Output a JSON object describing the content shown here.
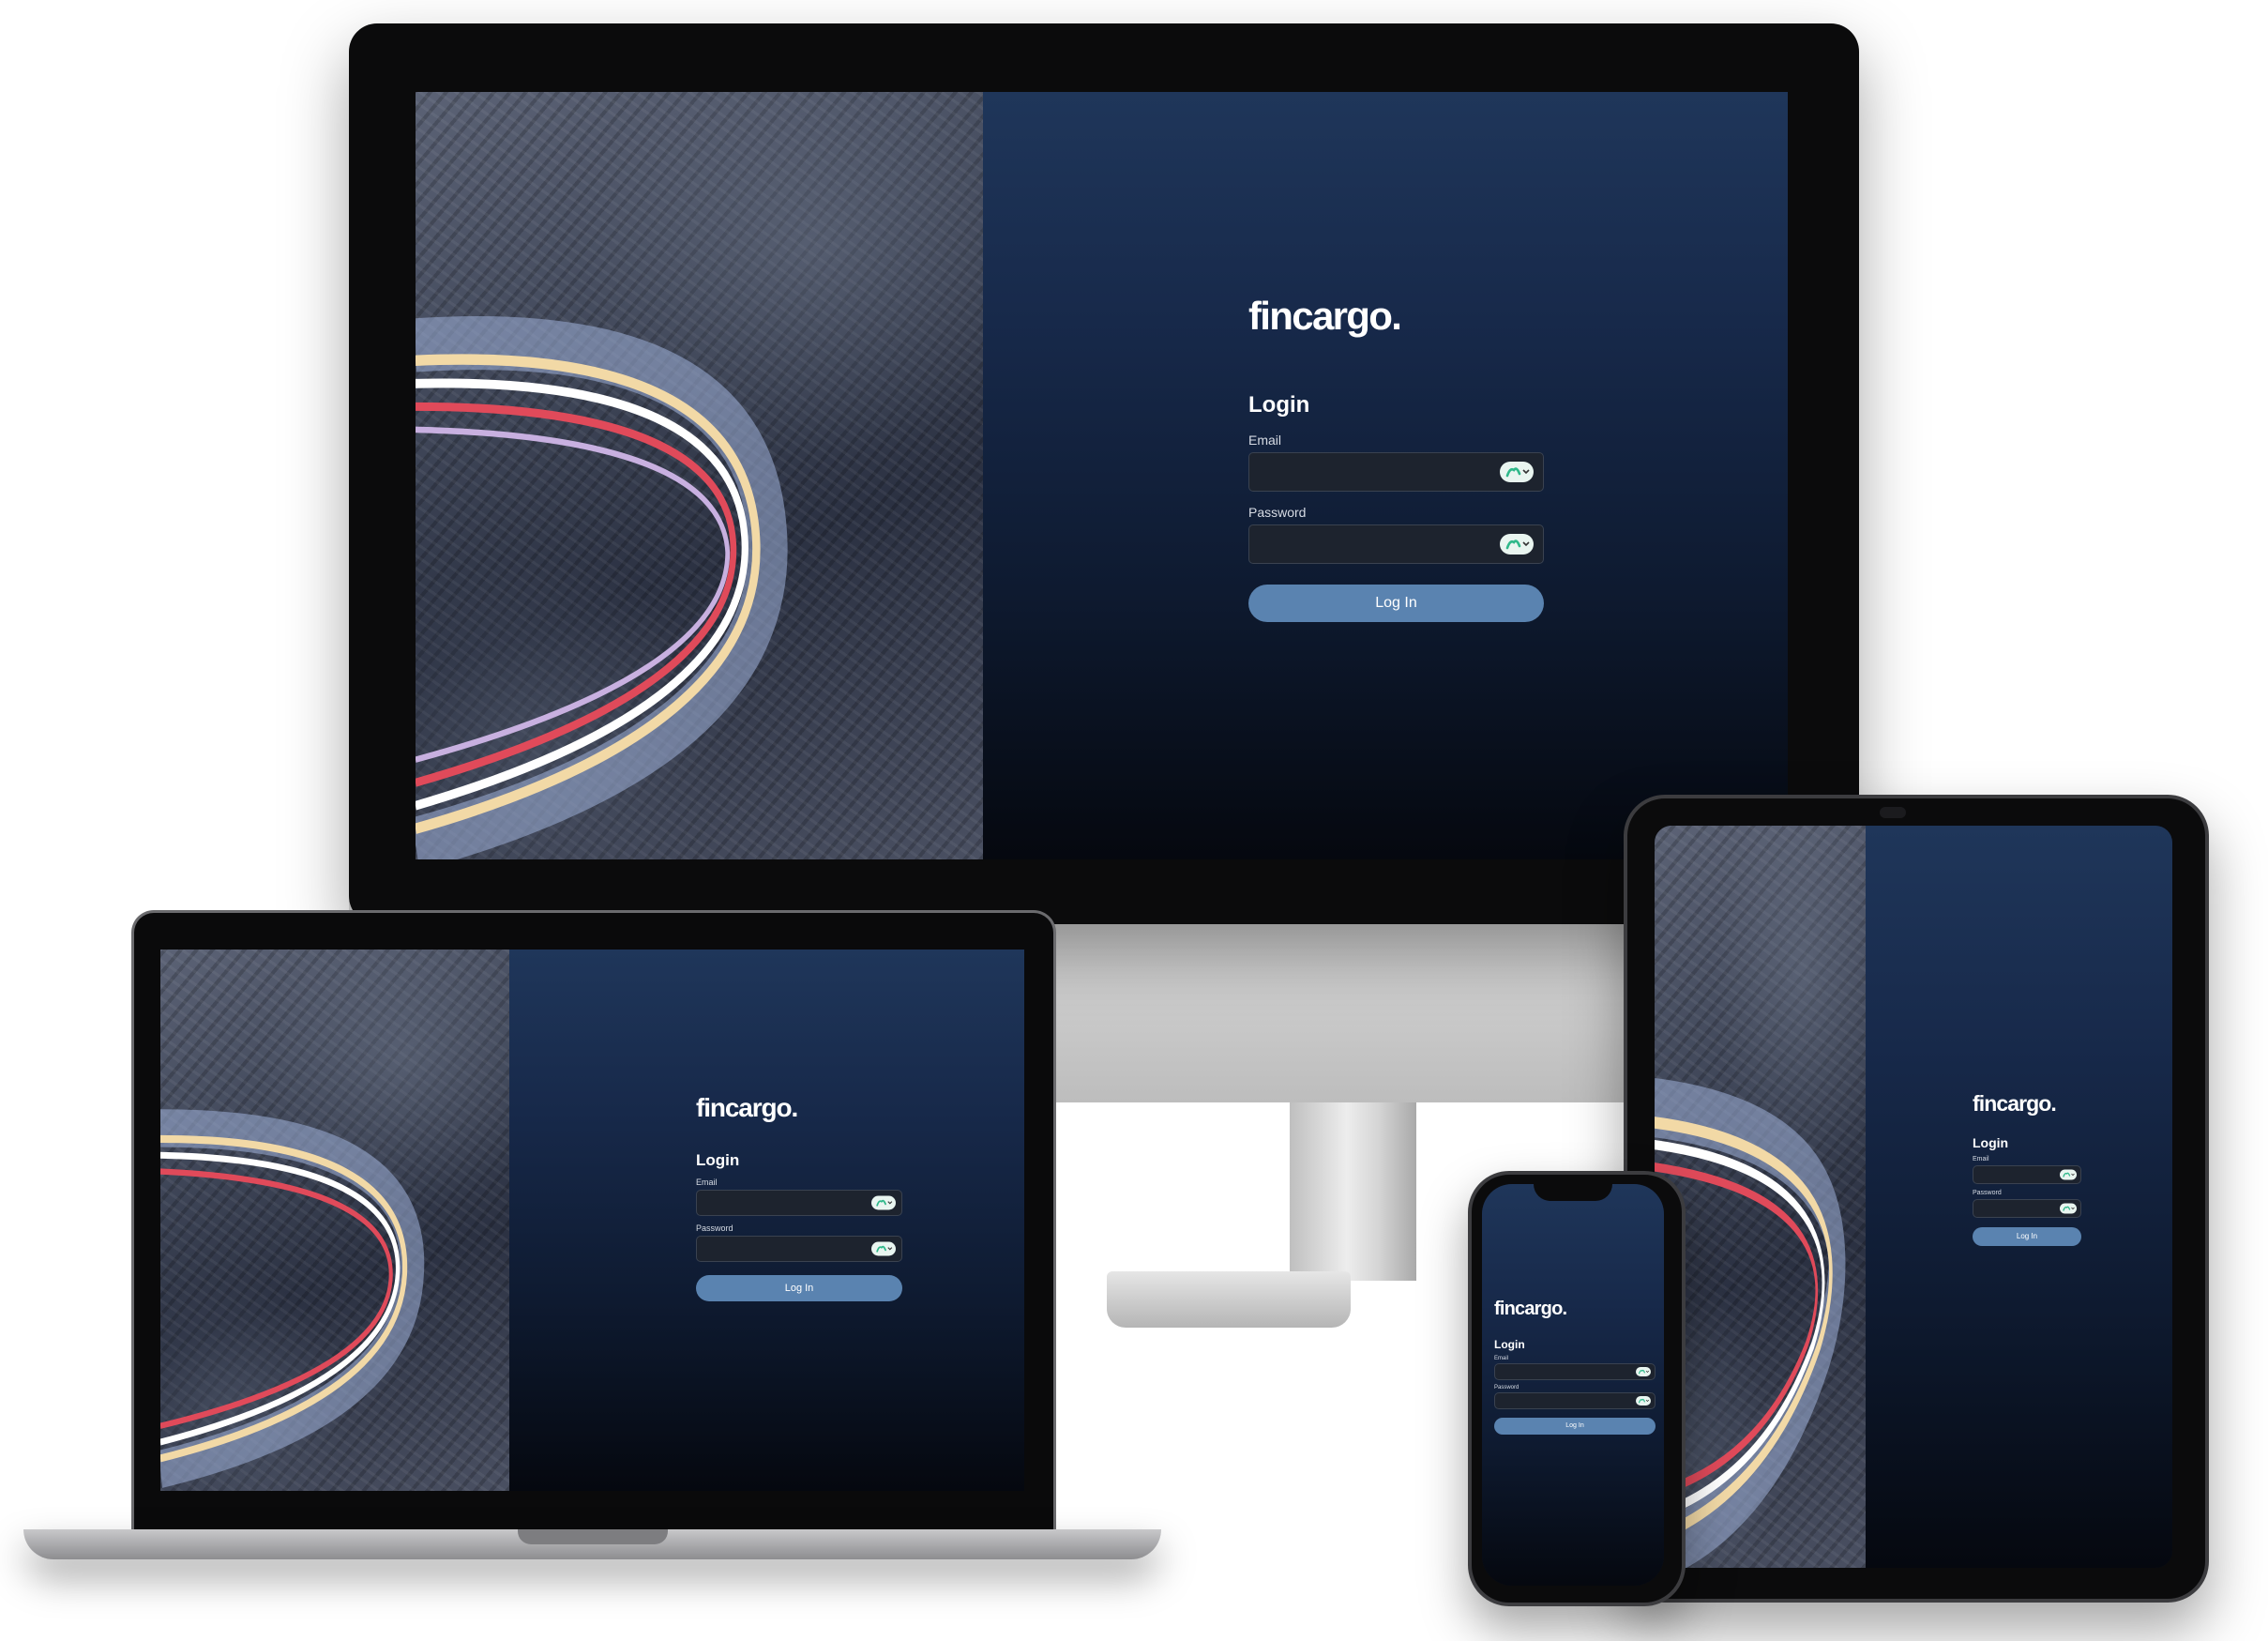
{
  "brand": {
    "logo": "fincargo."
  },
  "login": {
    "heading": "Login",
    "email_label": "Email",
    "password_label": "Password",
    "button_label": "Log In"
  },
  "icons": {
    "photo": "mountain-road-light-trails-photo",
    "password_manager": "password-manager-icon"
  },
  "colors": {
    "panel_top": "#1f365a",
    "panel_bottom": "#05080f",
    "button": "#5a83b0",
    "field_bg": "#1d232e",
    "pill_accent": "#2fb88a"
  }
}
